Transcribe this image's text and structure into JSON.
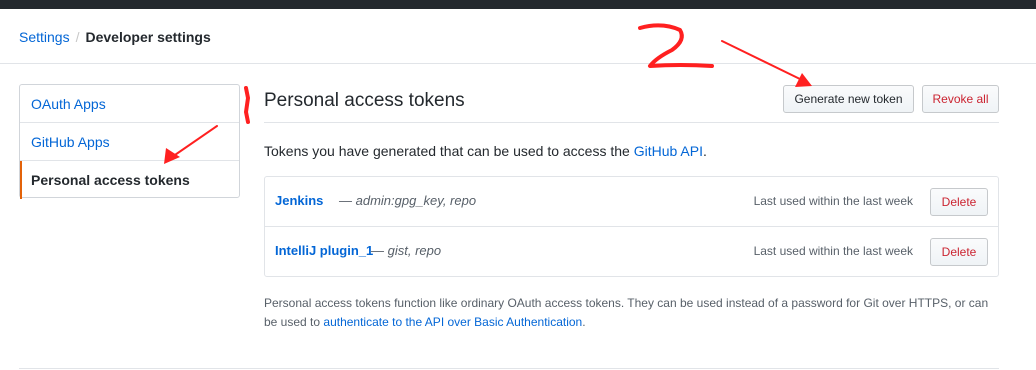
{
  "breadcrumb": {
    "root": "Settings",
    "separator": "/",
    "current": "Developer settings"
  },
  "sidebar": {
    "items": [
      {
        "label": "OAuth Apps"
      },
      {
        "label": "GitHub Apps"
      },
      {
        "label": "Personal access tokens"
      }
    ]
  },
  "main": {
    "title": "Personal access tokens",
    "generate_button": "Generate new token",
    "revoke_button": "Revoke all",
    "intro_text": "Tokens you have generated that can be used to access the ",
    "intro_link": "GitHub API",
    "intro_end": ".",
    "tokens": [
      {
        "name": "Jenkins",
        "scopes": "— admin:gpg_key, repo",
        "last_used": "Last used within the last week",
        "delete_label": "Delete"
      },
      {
        "name": "IntelliJ plugin_1",
        "scopes": "— gist, repo",
        "last_used": "Last used within the last week",
        "delete_label": "Delete"
      }
    ],
    "note_text": "Personal access tokens function like ordinary OAuth access tokens. They can be used instead of a password for Git over HTTPS, or can be used to ",
    "note_link": "authenticate to the API over Basic Authentication",
    "note_end": "."
  },
  "annotations": {
    "label_1": "1",
    "label_2": "2",
    "color": "#ff2020"
  },
  "colors": {
    "link": "#0366d6",
    "danger": "#cb2431",
    "selected_accent": "#e36209"
  }
}
